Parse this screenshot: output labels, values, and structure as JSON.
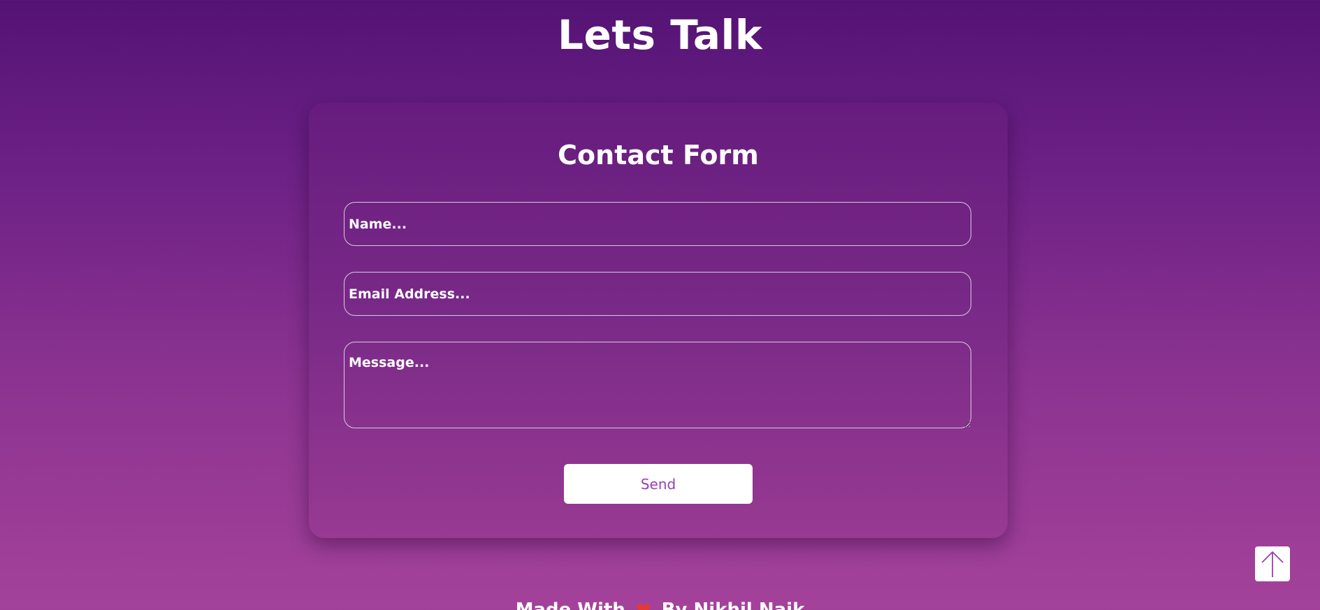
{
  "header": {
    "title": "Lets Talk"
  },
  "contact_form": {
    "title": "Contact Form",
    "name_placeholder": "Name...",
    "email_placeholder": "Email Address...",
    "message_placeholder": "Message...",
    "send_label": "Send"
  },
  "scroll_top": {
    "icon": "arrow-up-icon"
  },
  "footer": {
    "made_with": "Made With",
    "heart_icon": "heart-icon",
    "heart_glyph": "❤",
    "by": "By Nikhil Naik"
  },
  "colors": {
    "background_top": "#541374",
    "background_bottom": "#a4429a",
    "button_text": "#9a3fb2",
    "heart": "#e53935"
  }
}
